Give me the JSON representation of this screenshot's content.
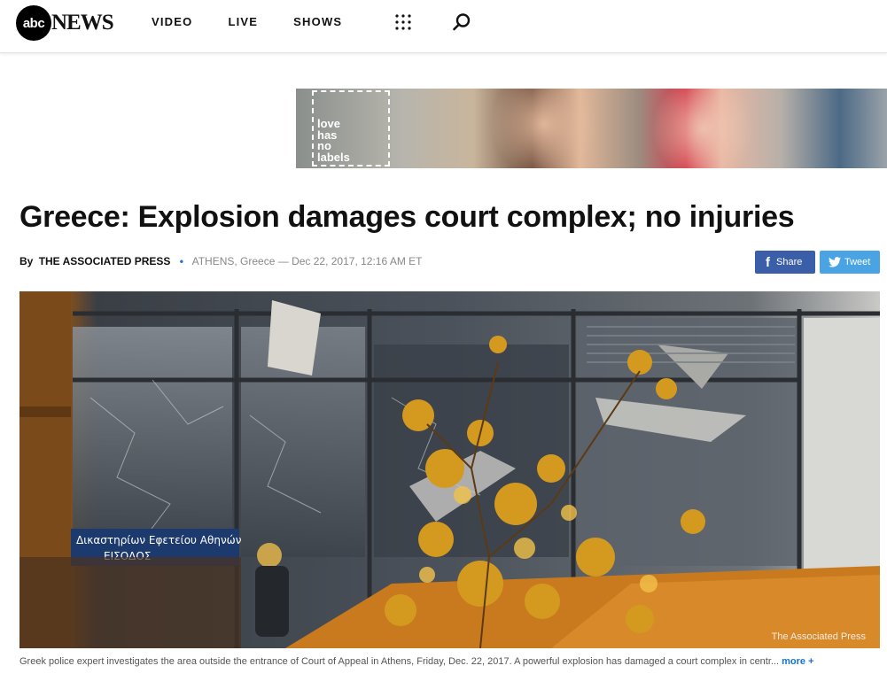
{
  "header": {
    "logo_mark": "abc",
    "logo_text": "NEWS",
    "nav": [
      "VIDEO",
      "LIVE",
      "SHOWS"
    ]
  },
  "ad": {
    "badge_lines": [
      "love",
      "has",
      "no",
      "labels"
    ]
  },
  "article": {
    "headline": "Greece: Explosion damages court complex; no injuries",
    "by": "By",
    "author": "THE ASSOCIATED PRESS",
    "separator": "•",
    "meta": "ATHENS, Greece — Dec 22, 2017, 12:16 AM ET",
    "share": {
      "facebook_icon": "f",
      "facebook_label": "Share",
      "twitter_label": "Tweet"
    },
    "image": {
      "credit": "The Associated Press",
      "sign_line1": "Δικαστηρίων Εφετείου Αθηνών",
      "sign_line2": "ΕΙΣΟΔΟΣ"
    },
    "caption": "Greek police expert investigates the area outside the entrance of Court of Appeal in Athens, Friday, Dec. 22, 2017. A powerful explosion has damaged a court complex in centr...",
    "caption_more": "more +"
  },
  "colors": {
    "facebook": "#3b5ea8",
    "twitter": "#4aa4e4",
    "accent": "#1a73d0"
  },
  "icons": [
    "grid-menu-icon",
    "search-icon",
    "facebook-icon",
    "twitter-icon"
  ]
}
